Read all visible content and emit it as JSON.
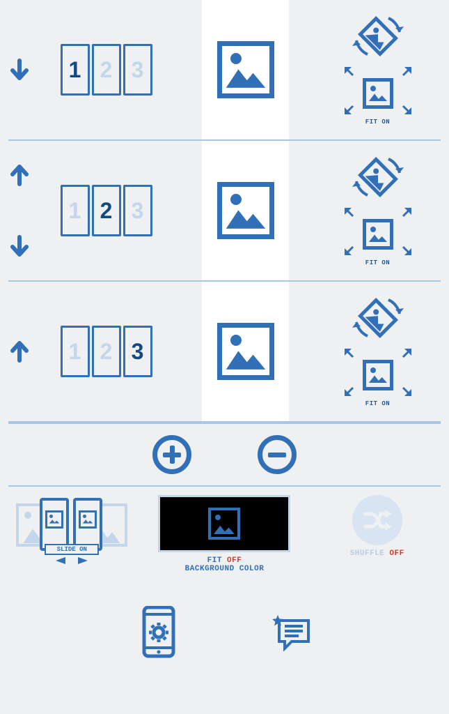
{
  "rows": [
    {
      "arrows": {
        "up": false,
        "down": true
      },
      "cards": {
        "count": 3,
        "selected": 1,
        "labels": [
          "1",
          "2",
          "3"
        ]
      },
      "fit_label": "FIT ON"
    },
    {
      "arrows": {
        "up": true,
        "down": true
      },
      "cards": {
        "count": 3,
        "selected": 2,
        "labels": [
          "1",
          "2",
          "3"
        ]
      },
      "fit_label": "FIT ON"
    },
    {
      "arrows": {
        "up": true,
        "down": false
      },
      "cards": {
        "count": 3,
        "selected": 3,
        "labels": [
          "1",
          "2",
          "3"
        ]
      },
      "fit_label": "FIT ON"
    }
  ],
  "plus_minus": {
    "plus": "add-image",
    "minus": "remove-image"
  },
  "options": {
    "slide": {
      "label": "SLIDE ON"
    },
    "fit": {
      "line1_a": "FIT ",
      "line1_b": "OFF",
      "line2": "BACKGROUND COLOR"
    },
    "shuffle": {
      "label_a": "SHUFFLE ",
      "label_b": "OFF"
    }
  }
}
